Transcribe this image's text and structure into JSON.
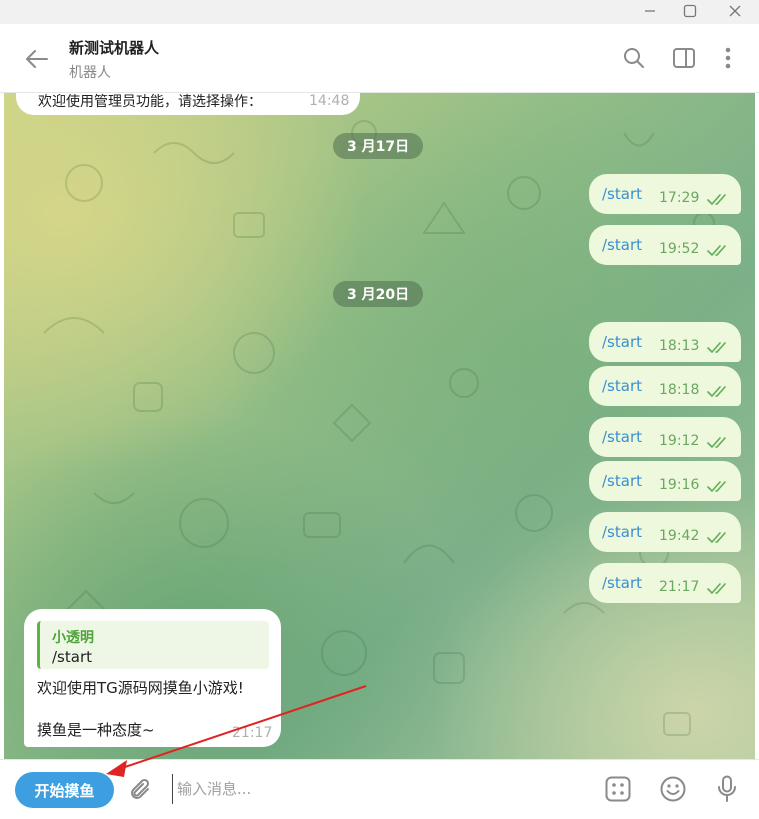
{
  "window": {
    "controls": [
      "minimize-icon",
      "maximize-icon",
      "close-icon"
    ]
  },
  "header": {
    "title": "新测试机器人",
    "subtitle": "机器人",
    "icons": [
      "back-arrow-icon",
      "search-icon",
      "sidebar-toggle-icon",
      "more-vertical-icon"
    ]
  },
  "messages": {
    "top_partial": {
      "text": "欢迎使用管理员功能，请选择操作：",
      "time": "14:48"
    },
    "date_1": "3 月17日",
    "date_2": "3 月20日",
    "outgoing": [
      {
        "text": "/start",
        "time": "17:29"
      },
      {
        "text": "/start",
        "time": "19:52"
      },
      {
        "text": "/start",
        "time": "18:13"
      },
      {
        "text": "/start",
        "time": "18:18"
      },
      {
        "text": "/start",
        "time": "19:12"
      },
      {
        "text": "/start",
        "time": "19:16"
      },
      {
        "text": "/start",
        "time": "19:42"
      },
      {
        "text": "/start",
        "time": "21:17"
      }
    ],
    "incoming": {
      "reply_author": "小透明",
      "reply_text": "/start",
      "line1": "欢迎使用TG源码网摸鱼小游戏!",
      "line2": "摸鱼是一种态度~",
      "time": "21:17"
    }
  },
  "composer": {
    "button_label": "开始摸鱼",
    "placeholder": "输入消息...",
    "icons": [
      "paperclip-icon",
      "grid-icon",
      "emoji-icon",
      "microphone-icon"
    ]
  },
  "colors": {
    "accent": "#3e9fe0",
    "outgoing_bubble": "#eef8dd",
    "check": "#5fae55",
    "reply_bar": "#5fb43f",
    "annotation_arrow": "#e02424"
  }
}
